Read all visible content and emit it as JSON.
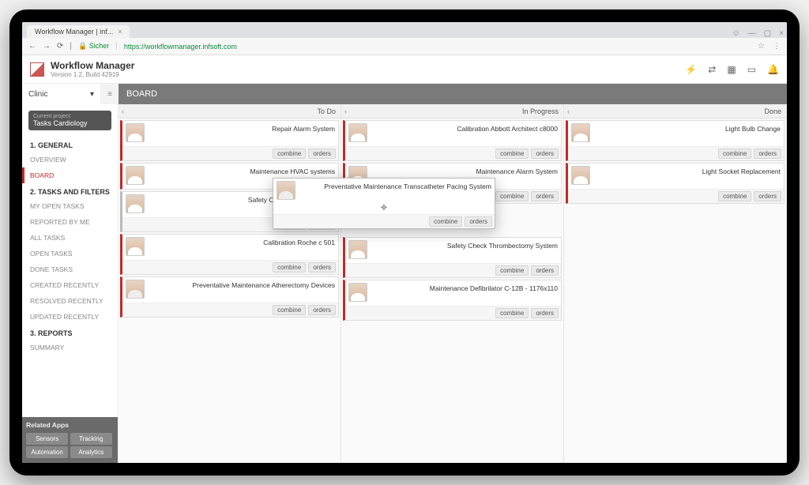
{
  "browser": {
    "tab_title": "Workflow Manager | inf...",
    "secure_label": "Sicher",
    "url_host": "https://workflowmanager.infsoft.com",
    "url_path": ""
  },
  "app": {
    "title": "Workflow Manager",
    "subtitle": "Version 1.2, Build 42919"
  },
  "clinic_label": "Clinic",
  "board_title": "BOARD",
  "project": {
    "label": "Current project:",
    "value": "Tasks Cardiology"
  },
  "nav": {
    "sec1": "1. GENERAL",
    "overview": "OVERVIEW",
    "board": "BOARD",
    "sec2": "2. TASKS AND FILTERS",
    "my_open": "MY OPEN TASKS",
    "reported": "REPORTED BY ME",
    "all": "ALL TASKS",
    "open": "OPEN TASKS",
    "done": "DONE TASKS",
    "created": "CREATED RECENTLY",
    "resolved": "RESOLVED RECENTLY",
    "updated": "UPDATED RECENTLY",
    "sec3": "3. REPORTS",
    "summary": "SUMMARY"
  },
  "related": {
    "header": "Related Apps",
    "b1": "Sensors",
    "b2": "Tracking",
    "b3": "Automation",
    "b4": "Analytics"
  },
  "columns": {
    "todo": "To Do",
    "inprogress": "In Progress",
    "done": "Done"
  },
  "pills": {
    "combine": "combine",
    "orders": "orders"
  },
  "cards": {
    "todo": [
      "Repair Alarm System",
      "Maintenance HVAC systems",
      "Safety Check Implantable Ca",
      "Calibration Roche c 501",
      "Preventative Maintenance Atherectomy Devices"
    ],
    "inprogress": [
      "Calibration Abbott Architect c8000",
      "Maintenance Alarm System",
      "Safety Check Thrombectomy System",
      "Maintenance Defibrilator C-12B - 1176x110"
    ],
    "done": [
      "Light Bulb Change",
      "Light Socket Replacement"
    ],
    "floating": "Preventative Maintenance Transcatheter Pacing System"
  }
}
